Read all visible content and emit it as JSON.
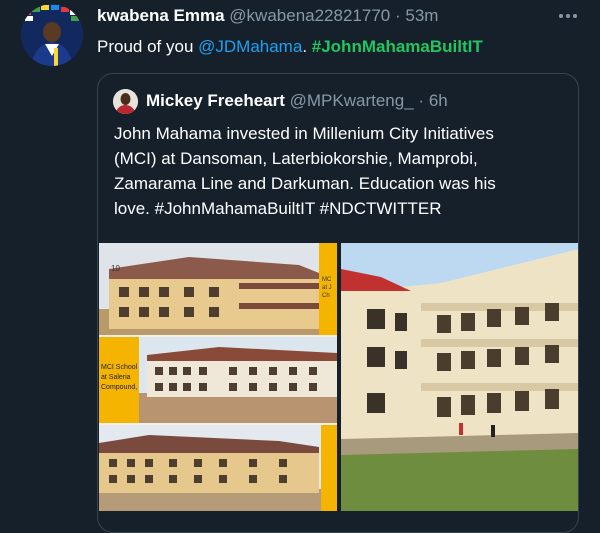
{
  "tweet": {
    "author_name": "kwabena Emma",
    "author_handle": "@kwabena22821770",
    "separator": "·",
    "time": "53m",
    "text_prefix": "Proud of you ",
    "mention": "@JDMahama",
    "text_mid": ". ",
    "hashtag": "#JohnMahamaBuiltIT",
    "more_icon": "more-horizontal-icon"
  },
  "quoted_tweet": {
    "author_name": "Mickey Freeheart",
    "author_handle": "@MPKwarteng_",
    "separator": "·",
    "time": "6h",
    "lines": [
      "John Mahama invested in Millenium City Initiatives",
      "(MCI) at Dansoman, Laterbiokorshie, Mamprobi,",
      "Zamarama Line and Darkuman. Education was his",
      "love. #JohnMahamaBuiltIT #NDCTWITTER"
    ],
    "images": {
      "left_captions": [
        "10",
        "MCI School",
        "at Saleria",
        "Compound,"
      ],
      "side_labels": [
        "MC",
        "at J",
        "Ch"
      ]
    }
  },
  "colors": {
    "background": "#15202b",
    "text_primary": "#ffffff",
    "text_secondary": "#8899a6",
    "mention": "#1da1f2",
    "hashtag": "#22c55e",
    "border": "#38444d",
    "yellow_accent": "#f4b400"
  }
}
